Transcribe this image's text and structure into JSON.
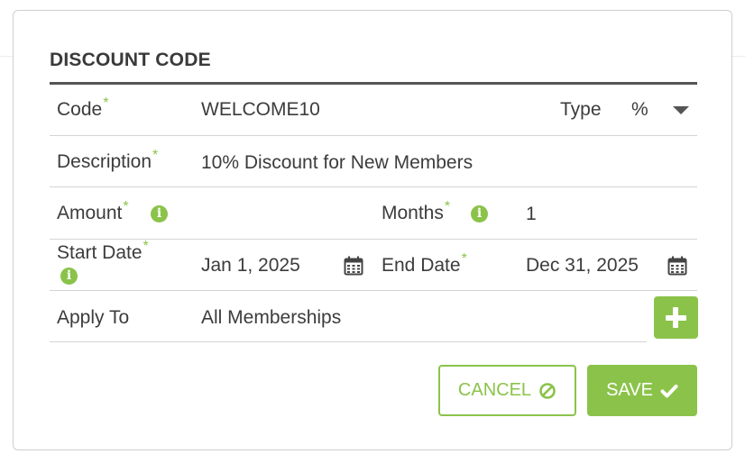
{
  "dialog": {
    "title": "DISCOUNT CODE",
    "required_mark": "*"
  },
  "fields": {
    "code": {
      "label": "Code",
      "value": "WELCOME10"
    },
    "type": {
      "label": "Type",
      "value": "%"
    },
    "description": {
      "label": "Description",
      "value": "10% Discount for New Members"
    },
    "amount": {
      "label": "Amount",
      "value": ""
    },
    "months": {
      "label": "Months",
      "value": "1"
    },
    "start_date": {
      "label": "Start Date",
      "value": "Jan 1, 2025"
    },
    "end_date": {
      "label": "End Date",
      "value": "Dec 31, 2025"
    },
    "apply_to": {
      "label": "Apply To",
      "value": "All Memberships"
    }
  },
  "buttons": {
    "cancel": "CANCEL",
    "save": "SAVE"
  },
  "icons": {
    "info": "info-icon",
    "calendar": "calendar-icon",
    "dropdown": "chevron-down-icon",
    "add": "plus-icon",
    "cancel": "ban-icon",
    "save": "check-icon"
  },
  "colors": {
    "accent": "#8bc34a",
    "text": "#3c3c3c",
    "border": "#d4d4d4",
    "heading_rule": "#555555"
  }
}
